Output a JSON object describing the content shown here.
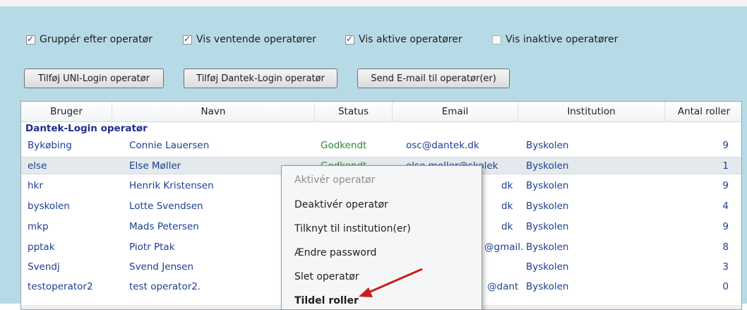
{
  "filters": [
    {
      "label": "Gruppér efter operatør",
      "checked": true
    },
    {
      "label": "Vis ventende operatører",
      "checked": true
    },
    {
      "label": "Vis aktive operatører",
      "checked": true
    },
    {
      "label": "Vis inaktive operatører",
      "checked": false
    }
  ],
  "buttons": {
    "add_uni": "Tilføj UNI-Login operatør",
    "add_dantek": "Tilføj Dantek-Login operatør",
    "send_email": "Send E-mail til operatør(er)"
  },
  "columns": {
    "bruger": "Bruger",
    "navn": "Navn",
    "status": "Status",
    "email": "Email",
    "institution": "Institution",
    "roller": "Antal roller"
  },
  "group_label": "Dantek-Login operatør",
  "rows": [
    {
      "bruger": "Bykøbing",
      "navn": "Connie Lauersen",
      "status": "Godkendt",
      "email": "osc@dantek.dk",
      "institution": "Byskolen",
      "roller": "9"
    },
    {
      "bruger": "else",
      "navn": "Else Møller",
      "status": "Godkendt",
      "email": "else.moller@skolek",
      "institution": "Byskolen",
      "roller": "1"
    },
    {
      "bruger": "hkr",
      "navn": "Henrik Kristensen",
      "status": "",
      "email": "dk",
      "institution": "Byskolen",
      "roller": "9"
    },
    {
      "bruger": "byskolen",
      "navn": "Lotte Svendsen",
      "status": "",
      "email": "dk",
      "institution": "Byskolen",
      "roller": "4"
    },
    {
      "bruger": "mkp",
      "navn": "Mads Petersen",
      "status": "",
      "email": "dk",
      "institution": "Byskolen",
      "roller": "9"
    },
    {
      "bruger": "pptak",
      "navn": "Piotr Ptak",
      "status": "",
      "email": "@gmail.",
      "institution": "Byskolen",
      "roller": "8"
    },
    {
      "bruger": "Svendj",
      "navn": "Svend Jensen",
      "status": "",
      "email": "",
      "institution": "Byskolen",
      "roller": "3"
    },
    {
      "bruger": "testoperator2",
      "navn": "test operator2.",
      "status": "",
      "email": "@dant",
      "institution": "Byskolen",
      "roller": "0"
    }
  ],
  "context_menu": [
    {
      "label": "Aktivér operatør",
      "enabled": false
    },
    {
      "label": "Deaktivér operatør",
      "enabled": true
    },
    {
      "label": "Tilknyt til institution(er)",
      "enabled": true
    },
    {
      "label": "Ændre password",
      "enabled": true
    },
    {
      "label": "Slet operatør",
      "enabled": true
    },
    {
      "label": "Tildel roller",
      "enabled": true
    }
  ],
  "colors": {
    "accent": "#1c3f91",
    "status_ok": "#2c8a2c",
    "panel": "#b7dbe6",
    "arrow": "#c81e1e"
  }
}
